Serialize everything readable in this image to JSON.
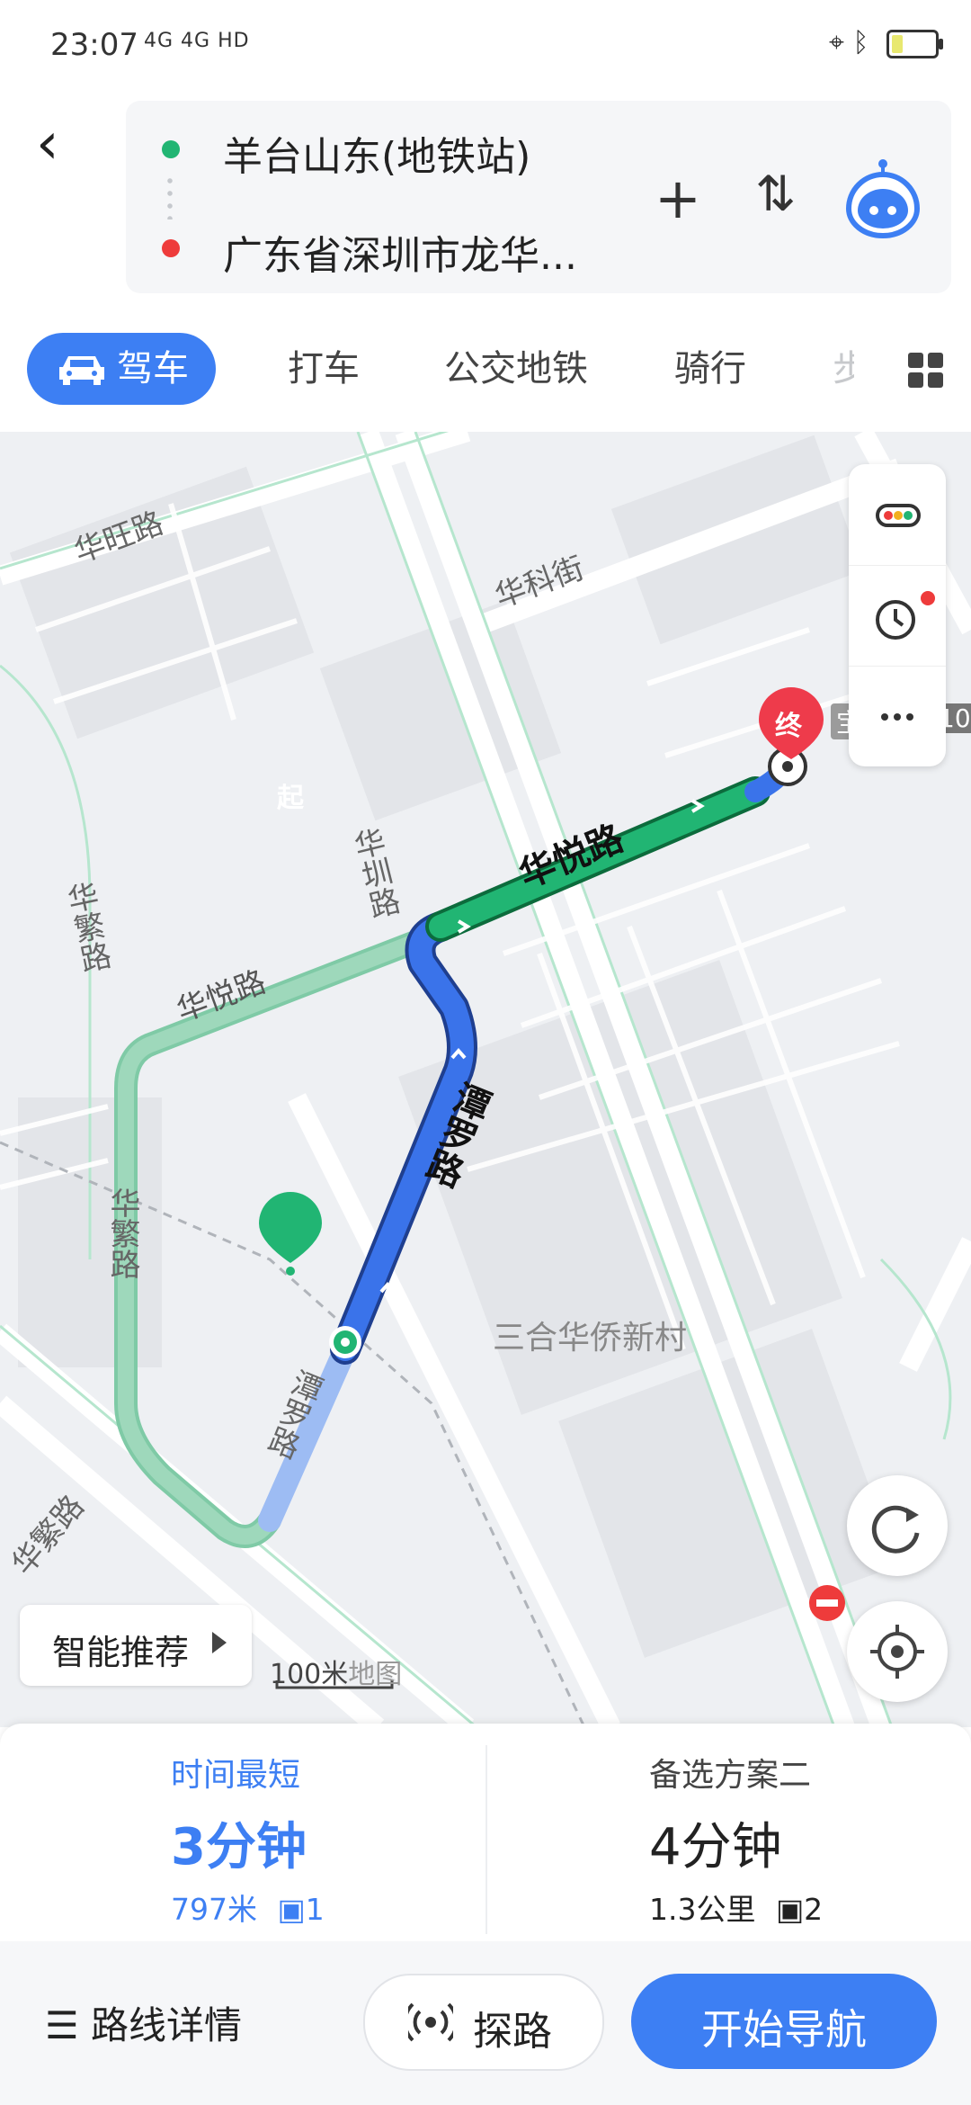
{
  "status_bar": {
    "time": "23:07",
    "network": "4G 4G HD",
    "icons": [
      "location-icon",
      "bluetooth-icon",
      "battery-icon"
    ]
  },
  "route": {
    "origin": "羊台山东(地铁站)",
    "destination": "广东省深圳市龙华...",
    "origin_color": "#21b573",
    "destination_color": "#ee3b3b"
  },
  "tabs": [
    {
      "label": "驾车",
      "active": true
    },
    {
      "label": "打车"
    },
    {
      "label": "公交地铁"
    },
    {
      "label": "骑行"
    },
    {
      "label": "步"
    }
  ],
  "map": {
    "roads": [
      "华旺路",
      "华科街",
      "华圳路",
      "华繁路",
      "华悦路",
      "华悦路",
      "潭罗路",
      "华繁路",
      "潭罗路",
      "华繁路",
      "三合华侨新村"
    ],
    "route_labels": {
      "green": "华悦路",
      "blue": "潭罗路"
    },
    "start_marker": "起",
    "end_marker": "终",
    "scale": "100米",
    "watermark": "地图",
    "smart_recommend": "智能推荐",
    "edge_labels": [
      "宝",
      "10"
    ]
  },
  "plans": [
    {
      "label": "时间最短",
      "duration": "3分钟",
      "distance": "797米",
      "lights": "1",
      "selected": true
    },
    {
      "label": "备选方案二",
      "duration": "4分钟",
      "distance": "1.3公里",
      "lights": "2",
      "selected": false
    }
  ],
  "actions": {
    "detail": "路线详情",
    "probe": "探路",
    "navigate": "开始导航"
  },
  "colors": {
    "accent": "#3d7ff3",
    "route_green": "#21b573",
    "route_blue": "#3a73ea",
    "end_red": "#ee3b4b"
  }
}
